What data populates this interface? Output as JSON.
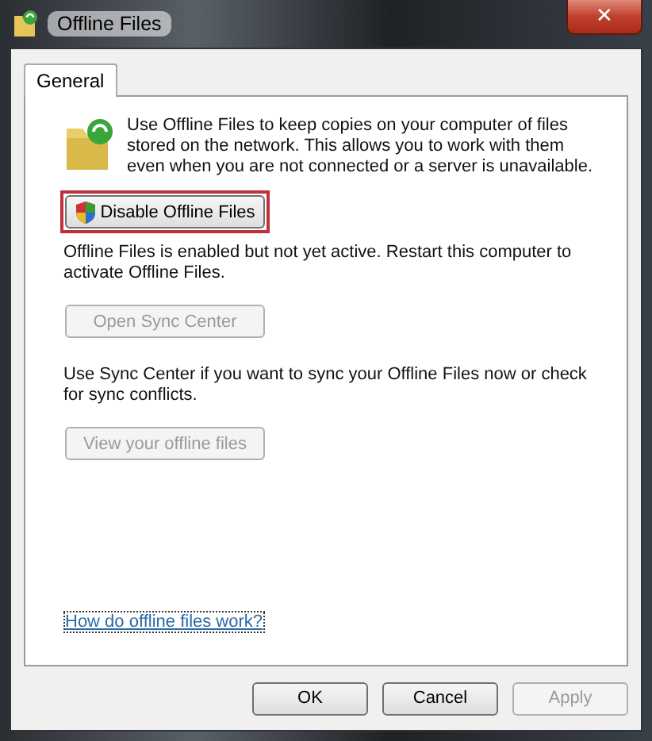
{
  "window": {
    "title": "Offline Files",
    "close": "✕"
  },
  "tabs": [
    {
      "label": "General",
      "selected": true
    }
  ],
  "intro": "Use Offline Files to keep copies on your computer of files stored on the network.  This allows you to work with them even when you are not connected or a server is unavailable.",
  "content": [
    {
      "kind": "button",
      "label": "Disable Offline Files",
      "disabled": false,
      "shield": true,
      "highlighted": true
    },
    {
      "kind": "text",
      "text": "Offline Files is enabled but not yet active.  Restart this computer to activate Offline Files."
    },
    {
      "kind": "button",
      "label": "Open Sync Center",
      "disabled": true,
      "shield": false,
      "highlighted": false
    },
    {
      "kind": "text",
      "text": "Use Sync Center if you want to sync your Offline Files now or check for sync conflicts."
    },
    {
      "kind": "button",
      "label": "View your offline files",
      "disabled": true,
      "shield": false,
      "highlighted": false
    }
  ],
  "help_link": "How do offline files work?",
  "buttons": [
    {
      "label": "OK",
      "disabled": false
    },
    {
      "label": "Cancel",
      "disabled": false
    },
    {
      "label": "Apply",
      "disabled": true
    }
  ]
}
